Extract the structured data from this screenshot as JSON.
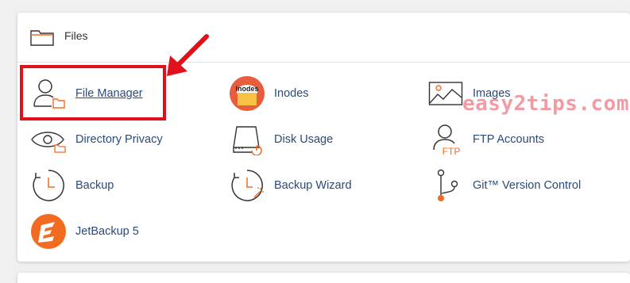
{
  "panel": {
    "title": "Files"
  },
  "items": {
    "file_manager": "File Manager",
    "inodes": "Inodes",
    "inodes_badge": "Inodes",
    "images": "Images",
    "directory_privacy": "Directory Privacy",
    "disk_usage": "Disk Usage",
    "ftp_accounts": "FTP Accounts",
    "ftp_badge": "FTP",
    "backup": "Backup",
    "backup_wizard": "Backup Wizard",
    "git_version_control": "Git™ Version Control",
    "jetbackup": "JetBackup 5"
  },
  "watermark": "easy2tips.com",
  "colors": {
    "link": "#2a4a7a",
    "accent_orange": "#f26b21",
    "highlight_red": "#e0111b"
  }
}
